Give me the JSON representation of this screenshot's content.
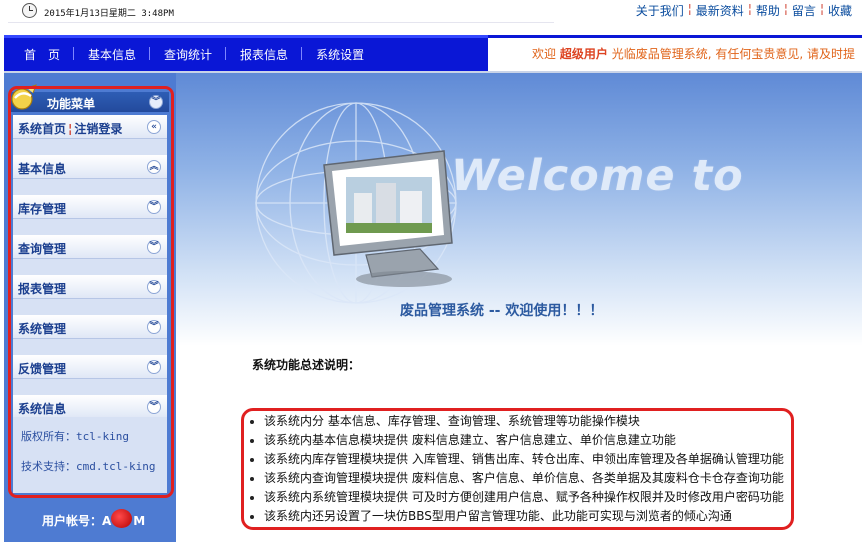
{
  "topbar": {
    "datetime": "2015年1月13日星期二 3:48PM",
    "links": [
      "关于我们",
      "最新资料",
      "帮助",
      "留言",
      "收藏"
    ]
  },
  "nav": {
    "items": [
      "首　页",
      "基本信息",
      "查询统计",
      "报表信息",
      "系统设置"
    ],
    "welcome_prefix": "欢迎",
    "welcome_user": "超级用户",
    "welcome_suffix": "光临废品管理系统, 有任何宝贵意见, 请及时提"
  },
  "sidebar": {
    "title": "功能菜单",
    "home_link": "系统首页",
    "logout_link": "注销登录",
    "items": [
      "基本信息",
      "库存管理",
      "查询管理",
      "报表管理",
      "系统管理",
      "反馈管理",
      "系统信息"
    ],
    "copyright": "版权所有：tcl-king",
    "support": "技术支持：cmd.tcl-king",
    "account_label": "用户帐号：A",
    "account_tail": "M"
  },
  "main": {
    "banner_text": "Welcome to",
    "system_title": "废品管理系统 -- 欢迎使用！！！",
    "overview_title": "系统功能总述说明：",
    "features": [
      "该系统内分 基本信息、库存管理、查询管理、系统管理等功能操作模块",
      "该系统内基本信息模块提供 废料信息建立、客户信息建立、单价信息建立功能",
      "该系统内库存管理模块提供 入库管理、销售出库、转仓出库、申领出库管理及各单据确认管理功能",
      "该系统内查询管理模块提供 废料信息、客户信息、单价信息、各类单据及其废料仓卡仓存查询功能",
      "该系统内系统管理模块提供 可及时方便创建用户信息、赋予各种操作权限并及时修改用户密码功能",
      "该系统内还另设置了一块仿BBS型用户留言管理功能、此功能可实现与浏览者的倾心沟通"
    ]
  },
  "colors": {
    "nav_bg": "#0a17d6",
    "sidebar_bg": "#4e7bd2",
    "highlight_frame": "#e02020",
    "welcome_orange": "#e0641a"
  },
  "icons": [
    "clock-icon",
    "menu-icon",
    "chevron-up-icon",
    "chevron-down-icon",
    "chevron-left-icon"
  ]
}
